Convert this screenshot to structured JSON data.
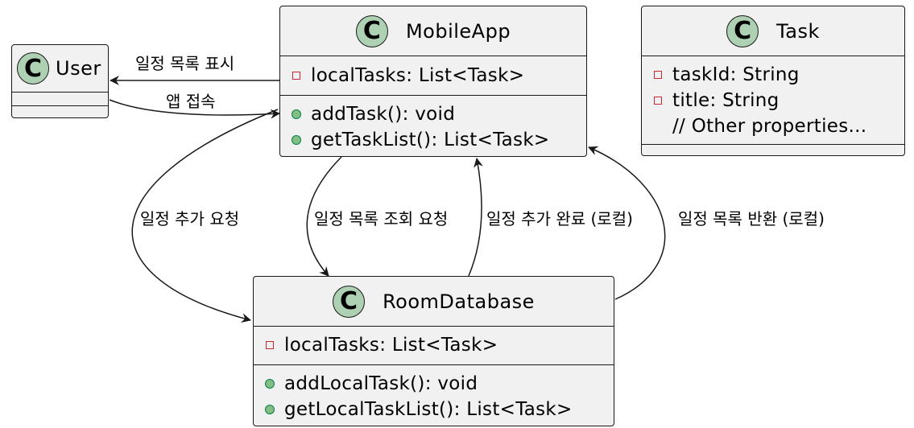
{
  "classes": {
    "user": {
      "icon": "C",
      "name": "User"
    },
    "mobileapp": {
      "icon": "C",
      "name": "MobileApp",
      "fields": [
        {
          "visibility": "private",
          "text": "localTasks: List<Task>"
        }
      ],
      "methods": [
        {
          "visibility": "public",
          "text": "addTask(): void"
        },
        {
          "visibility": "public",
          "text": "getTaskList(): List<Task>"
        }
      ]
    },
    "task": {
      "icon": "C",
      "name": "Task",
      "fields": [
        {
          "visibility": "private",
          "text": "taskId: String"
        },
        {
          "visibility": "private",
          "text": "title: String"
        },
        {
          "visibility": "none",
          "text": "// Other properties..."
        }
      ]
    },
    "roomdatabase": {
      "icon": "C",
      "name": "RoomDatabase",
      "fields": [
        {
          "visibility": "private",
          "text": "localTasks: List<Task>"
        }
      ],
      "methods": [
        {
          "visibility": "public",
          "text": "addLocalTask(): void"
        },
        {
          "visibility": "public",
          "text": "getLocalTaskList(): List<Task>"
        }
      ]
    }
  },
  "relations": {
    "show_schedule_list": "일정 목록 표시",
    "app_access": "앱 접속",
    "add_request": "일정 추가 요청",
    "list_query_request": "일정 목록 조회 요청",
    "add_complete_local": "일정 추가 완료 (로컬)",
    "list_return_local": "일정 목록 반환 (로컬)"
  },
  "colors": {
    "class_fill": "#f1f1f1",
    "border": "#181818",
    "class_icon_fill": "#add1b2",
    "private_marker": "#c82930",
    "public_marker_fill": "#84be84",
    "public_marker_stroke": "#038048"
  }
}
